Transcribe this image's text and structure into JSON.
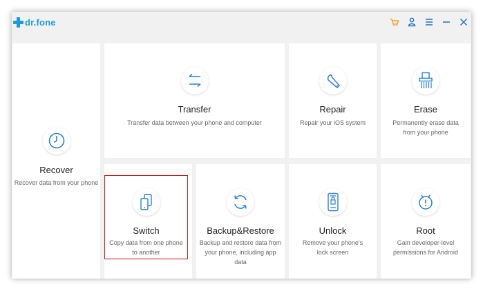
{
  "app": {
    "name": "dr.fone",
    "brand_color": "#1a9be0"
  },
  "window_controls": [
    {
      "name": "cart-icon",
      "color": "#f5a623"
    },
    {
      "name": "user-icon",
      "color": "#1a75c2"
    },
    {
      "name": "menu-icon",
      "color": "#1a75c2"
    },
    {
      "name": "minimize-icon",
      "color": "#1a75c2"
    },
    {
      "name": "close-icon",
      "color": "#1a75c2"
    }
  ],
  "tiles": {
    "recover": {
      "title": "Recover",
      "desc": "Recover data from your phone",
      "icon": "clock-icon"
    },
    "transfer": {
      "title": "Transfer",
      "desc": "Transfer data between your phone and computer",
      "icon": "transfer-arrows-icon"
    },
    "repair": {
      "title": "Repair",
      "desc": "Repair your iOS system",
      "icon": "wrench-icon"
    },
    "erase": {
      "title": "Erase",
      "desc": "Permanently erase data from your phone",
      "icon": "shredder-icon"
    },
    "switch": {
      "title": "Switch",
      "desc": "Copy data from one phone to another",
      "icon": "phones-switch-icon",
      "highlighted": true
    },
    "backup": {
      "title": "Backup&Restore",
      "desc": "Backup and restore data from your phone, including app data",
      "icon": "sync-icon"
    },
    "unlock": {
      "title": "Unlock",
      "desc": "Remove your phone's lock screen",
      "icon": "locked-phone-icon"
    },
    "root": {
      "title": "Root",
      "desc": "Gain developer-level permissions for Android",
      "icon": "android-root-icon"
    }
  },
  "highlight_color": "#c81e1e"
}
